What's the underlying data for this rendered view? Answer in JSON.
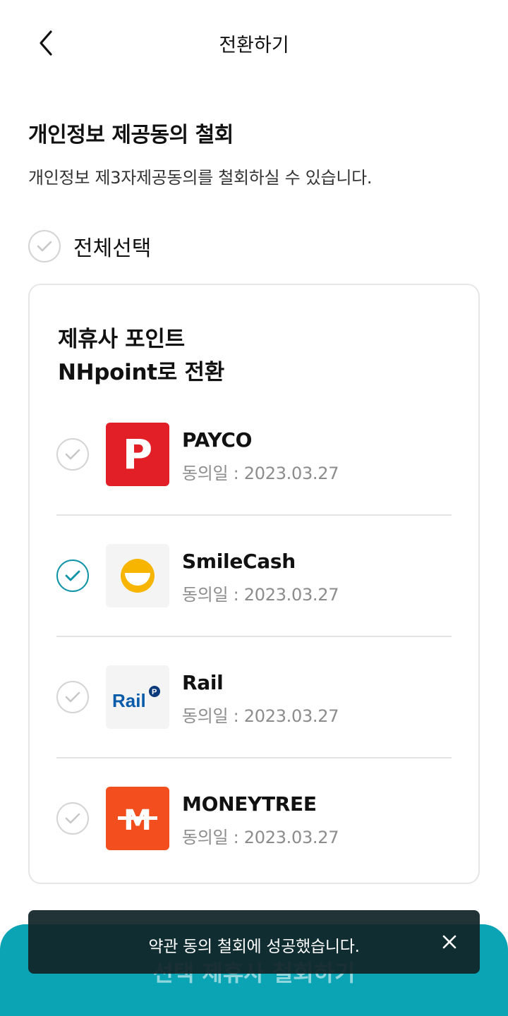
{
  "header": {
    "title": "전환하기",
    "back_icon": "chevron-left-icon"
  },
  "intro": {
    "title": "개인정보 제공동의 철회",
    "description": "개인정보 제3자제공동의를 철회하실 수 있습니다."
  },
  "select_all": {
    "label": "전체선택",
    "checked": false
  },
  "card": {
    "title_line1": "제휴사 포인트",
    "title_line2": "NHpoint로 전환",
    "partners": [
      {
        "name": "PAYCO",
        "date": "동의일 : 2023.03.27",
        "checked": false,
        "logo_text": "P",
        "logo_color": "#e21f26"
      },
      {
        "name": "SmileCash",
        "date": "동의일 : 2023.03.27",
        "checked": true,
        "logo_color": "#f7b500"
      },
      {
        "name": "Rail",
        "date": "동의일 : 2023.03.27",
        "checked": false,
        "logo_text": "Rail",
        "logo_color": "#0a5cab"
      },
      {
        "name": "MONEYTREE",
        "date": "동의일 : 2023.03.27",
        "checked": false,
        "logo_text": "M",
        "logo_color": "#f24e1e"
      }
    ]
  },
  "bottom_button": {
    "label": "선택 제휴사 철회하기",
    "color": "#0aa4b5"
  },
  "toast": {
    "message": "약관 동의 철회에 성공했습니다.",
    "close_icon": "close-icon"
  },
  "colors": {
    "accent": "#0e94a6",
    "check_off": "#d4d4d4"
  }
}
